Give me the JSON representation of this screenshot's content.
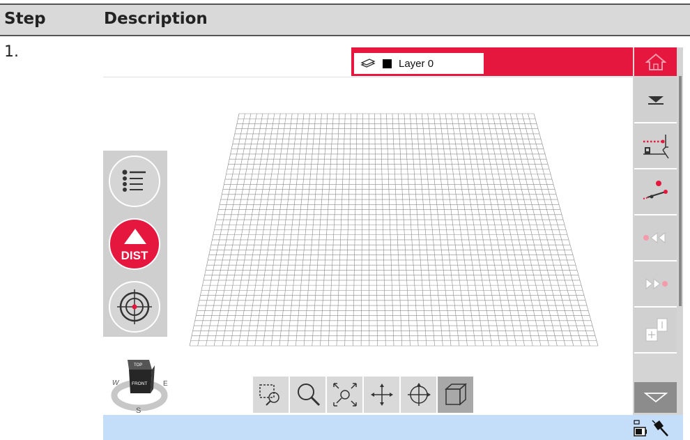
{
  "table": {
    "header_step": "Step",
    "header_description": "Description",
    "step_number": "1."
  },
  "screen": {
    "layer_name": "Layer 0",
    "dist_label": "DIST",
    "navcube": {
      "top_label": "TOP",
      "front_label": "FRONT",
      "west": "W",
      "east": "E",
      "south": "S"
    },
    "colors": {
      "accent_red": "#e5173f",
      "status_bar_blue": "#c4defa",
      "panel_grey": "#d0d0d0"
    },
    "right_toolbar_icons": [
      "home-icon",
      "dropdown-arrow-icon",
      "layer-measure-icon",
      "point-line-icon",
      "rewind-icon",
      "forward-icon",
      "split-icon"
    ],
    "bottom_tools": [
      "zoom-window-icon",
      "zoom-icon",
      "zoom-extents-icon",
      "pan-icon",
      "orbit-icon",
      "3d-box-icon"
    ]
  }
}
